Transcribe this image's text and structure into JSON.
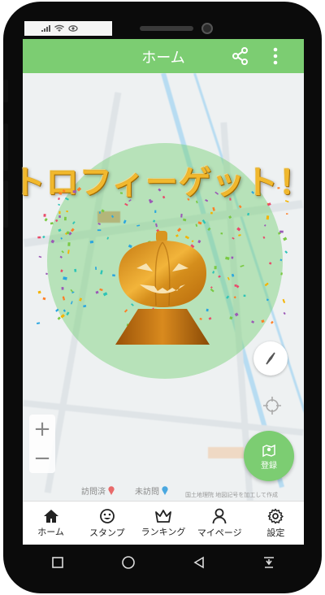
{
  "header": {
    "title": "ホーム",
    "share_icon": "share-icon",
    "menu_icon": "more-vertical-icon"
  },
  "overlay": {
    "title": "トロフィーゲット！",
    "trophy_icon": "pumpkin-trophy-icon"
  },
  "map": {
    "zoom_in": "+",
    "zoom_out": "−",
    "compass_icon": "compass-icon",
    "locate_icon": "crosshair-icon",
    "register_label": "登録",
    "legend": [
      {
        "label": "訪問済",
        "color": "#e86a6a"
      },
      {
        "label": "未訪問",
        "color": "#4aa8e0"
      }
    ],
    "credit": "国土地理院 地図記号を加工して作成"
  },
  "nav": [
    {
      "label": "ホーム",
      "icon": "home-icon"
    },
    {
      "label": "スタンプ",
      "icon": "stamp-face-icon"
    },
    {
      "label": "ランキング",
      "icon": "crown-icon"
    },
    {
      "label": "マイページ",
      "icon": "person-icon"
    },
    {
      "label": "設定",
      "icon": "gear-icon"
    }
  ],
  "colors": {
    "accent": "#7ccd72",
    "trophy_gold": "#f1b82d"
  }
}
